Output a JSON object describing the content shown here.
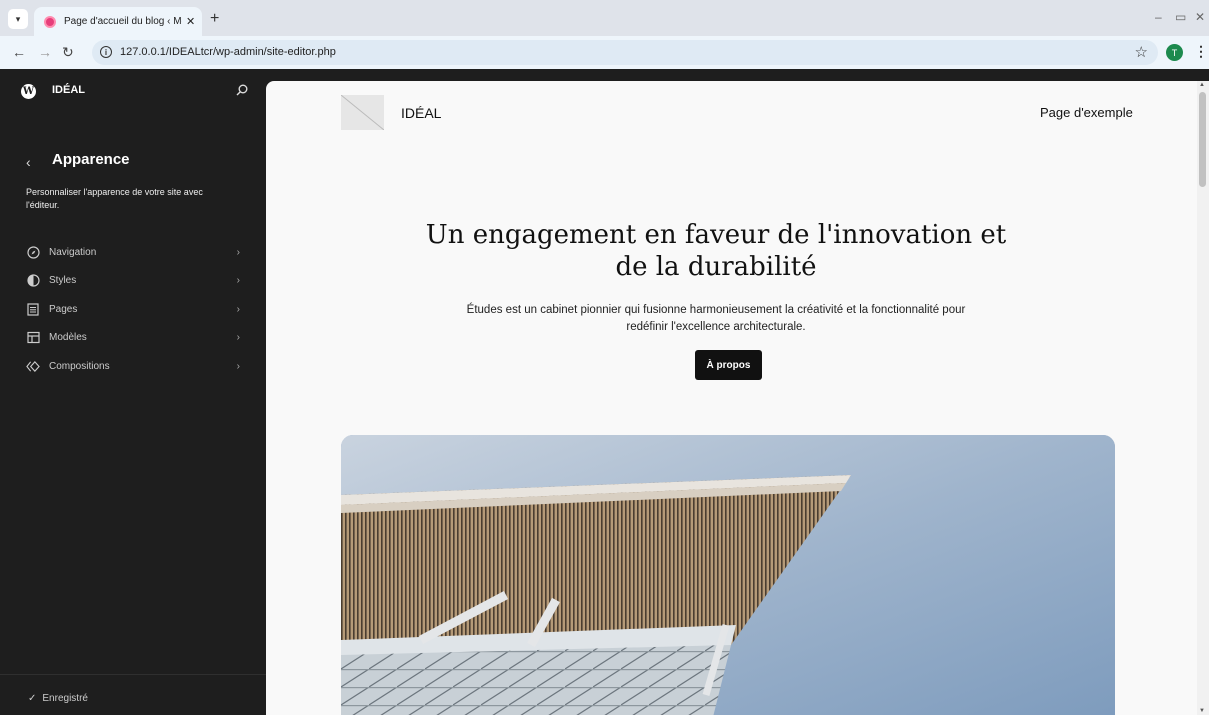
{
  "browser": {
    "tab_title": "Page d'accueil du blog ‹ Modèl",
    "tab_close": "✕",
    "new_tab": "+",
    "url": "127.0.0.1/IDEALtcr/wp-admin/site-editor.php",
    "profile_initial": "T",
    "controls": {
      "minimize": "–",
      "restore": "▭",
      "close": "✕"
    }
  },
  "sidebar": {
    "site_name": "IDÉAL",
    "panel_title": "Apparence",
    "panel_description": "Personnaliser l'apparence de votre site avec l'éditeur.",
    "items": [
      {
        "label": "Navigation",
        "icon": "navigation-icon"
      },
      {
        "label": "Styles",
        "icon": "styles-icon"
      },
      {
        "label": "Pages",
        "icon": "pages-icon"
      },
      {
        "label": "Modèles",
        "icon": "templates-icon"
      },
      {
        "label": "Compositions",
        "icon": "patterns-icon"
      }
    ],
    "save_status": "Enregistré"
  },
  "preview": {
    "site_title": "IDÉAL",
    "nav_link": "Page d'exemple",
    "heading": "Un engagement en faveur de l'innovation et de la durabilité",
    "text": "Études est un cabinet pionnier qui fusionne harmonieusement la créativité et la fonctionnalité pour redéfinir l'excellence architecturale.",
    "button": "À propos"
  },
  "colors": {
    "sidebar_bg": "#1e1e1e",
    "canvas_bg": "#f9f9f9",
    "button_bg": "#111111",
    "profile_avatar": "#1d8a4e"
  }
}
